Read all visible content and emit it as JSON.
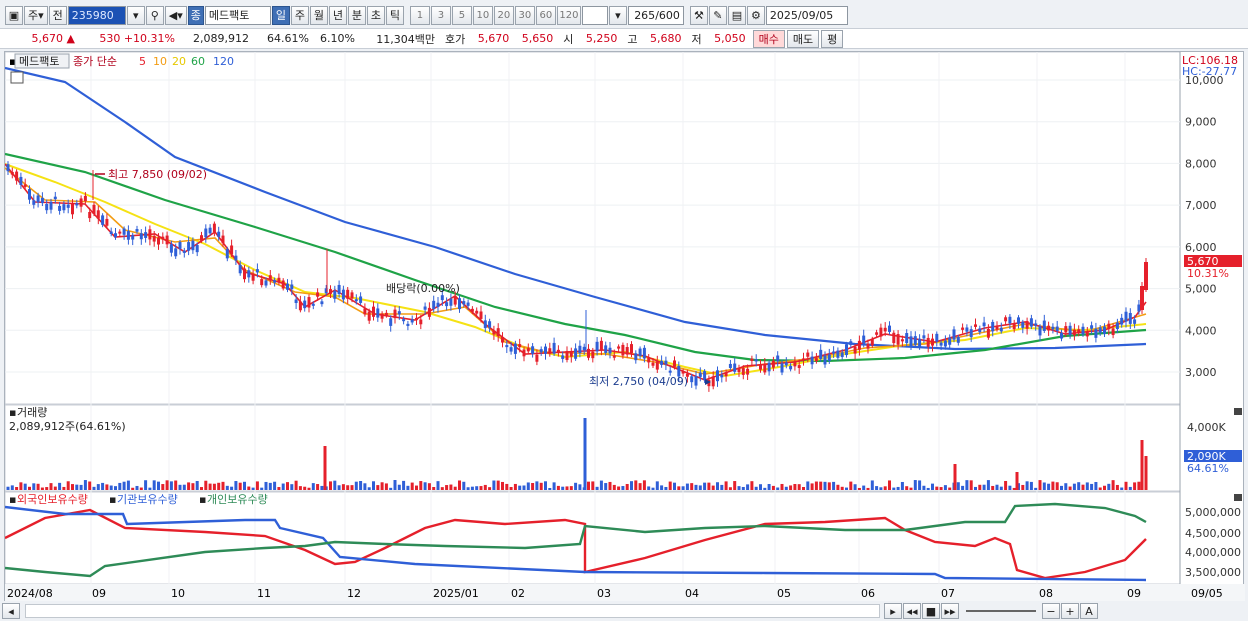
{
  "toolbar": {
    "market": "주",
    "code_label": "전",
    "code": "235980",
    "stock_badge": "종",
    "stock_name": "메드팩토",
    "periods": [
      "일",
      "주",
      "월",
      "년",
      "분",
      "초",
      "틱"
    ],
    "numbers": [
      "1",
      "3",
      "5",
      "10",
      "20",
      "30",
      "60",
      "120"
    ],
    "count": "265",
    "count_total": "/600",
    "date": "2025/09/05"
  },
  "quote": {
    "price": "5,670",
    "change": "530",
    "change_pct": "+10.31%",
    "volume": "2,089,912",
    "vol_ratio": "64.61%",
    "turnover": "6.10%",
    "amount": "11,304백만",
    "hoga_label": "호가",
    "hoga1": "5,670",
    "hoga2": "5,650",
    "open_label": "시",
    "open": "5,250",
    "high_label": "고",
    "high": "5,680",
    "low_label": "저",
    "low": "5,050",
    "buy": "매수",
    "sell": "매도",
    "eval": "평"
  },
  "price_panel": {
    "name": "메드팩토",
    "ma_label": "종가 단순",
    "ma_periods": [
      "5",
      "10",
      "20",
      "60",
      "120"
    ],
    "ma_colors": [
      "#e5202b",
      "#f39c12",
      "#f5e214",
      "#1fa347",
      "#2f5fd7"
    ],
    "lc": "LC:106.18",
    "hc": "HC:-27.77",
    "y_ticks": [
      "10,000",
      "9,000",
      "8,000",
      "7,000",
      "6,000",
      "5,000",
      "4,000",
      "3,000"
    ],
    "current_price": "5,670",
    "current_pct": "10.31%",
    "annot_high": "최고 7,850 (09/02)",
    "annot_low": "최저 2,750 (04/09)",
    "annot_div": "배당락(0.00%)"
  },
  "volume_panel": {
    "title": "거래량",
    "value": "2,089,912주(64.61%)",
    "y_tick": "4,000K",
    "current": "2,090K",
    "current_pct": "64.61%"
  },
  "holdings_panel": {
    "legend": [
      "외국인보유수량",
      "기관보유수량",
      "개인보유수량"
    ],
    "colors": [
      "#e5202b",
      "#2f5fd7",
      "#2e8b57"
    ],
    "y_ticks": [
      "5,000,000",
      "4,500,000",
      "4,000,000",
      "3,500,000"
    ]
  },
  "x_axis": {
    "labels": [
      "2024/08",
      "09",
      "10",
      "11",
      "12",
      "2025/01",
      "02",
      "03",
      "04",
      "05",
      "06",
      "07",
      "08",
      "09"
    ],
    "end_label": "09/05"
  },
  "icons": [
    "chart-icon",
    "dropdown-icon",
    "search-icon",
    "sound-icon",
    "tool-icon",
    "draw-icon",
    "save-icon",
    "gear-icon",
    "play-icon",
    "rewind-icon",
    "stop-icon",
    "forward-icon",
    "zoom-out-icon",
    "zoom-in-icon",
    "font-icon",
    "scroll-left-icon"
  ]
}
